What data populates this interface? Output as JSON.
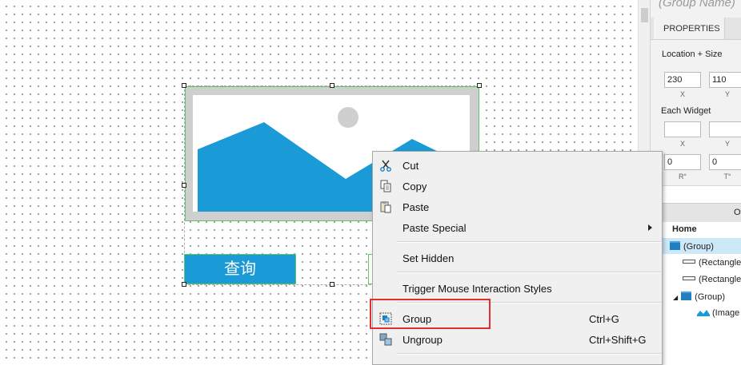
{
  "canvas": {
    "query_button_label": "查询"
  },
  "panel": {
    "group_name_placeholder": "(Group Name)",
    "tab_properties": "PROPERTIES",
    "location_size_label": "Location + Size",
    "x_value": "230",
    "y_value": "110",
    "x_caption": "X",
    "y_caption": "Y",
    "each_widget_label": "Each Widget",
    "each_x_caption": "X",
    "each_y_caption": "Y",
    "rotation_value": "0",
    "text_rotation_value": "0",
    "rotation_caption": "R°",
    "text_rotation_caption": "T°",
    "outline_tab_partial": "Ou",
    "outline": {
      "home": "Home",
      "group1": "(Group)",
      "rect1": "(Rectangle",
      "rect2": "(Rectangle",
      "group2": "(Group)",
      "image": "(Image"
    }
  },
  "menu": {
    "cut": "Cut",
    "copy": "Copy",
    "paste": "Paste",
    "paste_special": "Paste Special",
    "set_hidden": "Set Hidden",
    "trigger": "Trigger Mouse Interaction Styles",
    "group": "Group",
    "group_shortcut": "Ctrl+G",
    "ungroup": "Ungroup",
    "ungroup_shortcut": "Ctrl+Shift+G"
  },
  "colors": {
    "accent_blue": "#1a9ad6",
    "highlight_red": "#e0302e",
    "selection_green": "#5ec85e"
  }
}
